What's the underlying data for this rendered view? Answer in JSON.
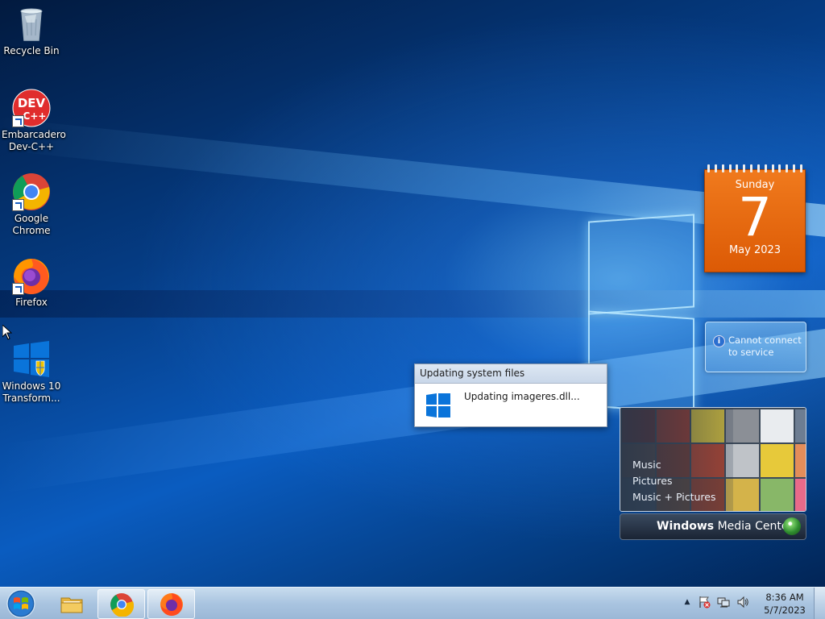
{
  "desktop": {
    "icons": [
      {
        "label": "Recycle Bin"
      },
      {
        "label": "Embarcadero Dev-C++"
      },
      {
        "label": "Google Chrome"
      },
      {
        "label": "Firefox"
      },
      {
        "label": "Windows 10 Transform..."
      }
    ],
    "devcpp_logo_text": "DEV",
    "devcpp_logo_sub": "C++"
  },
  "gadgets": {
    "calendar": {
      "weekday": "Sunday",
      "day": "7",
      "month_year": "May 2023"
    },
    "weather": {
      "message": "Cannot connect to service",
      "info_glyph": "i"
    },
    "media_center": {
      "menu": [
        "Music",
        "Pictures",
        "Music + Pictures"
      ],
      "brand_strong": "Windows",
      "brand_light": "Media Center"
    }
  },
  "dialog": {
    "title": "Updating system files",
    "message": "Updating imageres.dll..."
  },
  "taskbar": {
    "tray_expand_glyph": "▲",
    "clock_time": "8:36 AM",
    "clock_date": "5/7/2023"
  },
  "colors": {
    "calendar_orange": "#e8680f",
    "taskbar": "#b5cde6",
    "windows_blue": "#0a74da"
  }
}
